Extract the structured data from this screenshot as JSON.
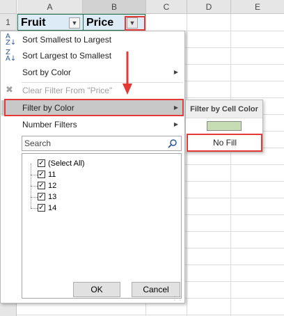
{
  "grid": {
    "columns": [
      "A",
      "B",
      "C",
      "D",
      "E"
    ],
    "rows": [
      "1"
    ],
    "header_fill_color": "#ddebf7",
    "cells": {
      "a1": "Fruit",
      "b1": "Price"
    }
  },
  "filter_menu": {
    "items": [
      {
        "label": "Sort Smallest to Largest",
        "icon": "sort-ascending-icon"
      },
      {
        "label": "Sort Largest to Smallest",
        "icon": "sort-descending-icon"
      },
      {
        "label": "Sort by Color",
        "icon": "",
        "has_submenu": true
      },
      {
        "label": "Clear Filter From \"Price\"",
        "icon": "clear-filter-icon",
        "disabled": true
      },
      {
        "label": "Filter by Color",
        "icon": "",
        "has_submenu": true,
        "highlighted": true
      },
      {
        "label": "Number Filters",
        "icon": "",
        "has_submenu": true
      }
    ],
    "search": {
      "placeholder": "Search",
      "icon": "search-icon"
    },
    "values": [
      {
        "label": "(Select All)",
        "checked": true
      },
      {
        "label": "11",
        "checked": true
      },
      {
        "label": "12",
        "checked": true
      },
      {
        "label": "13",
        "checked": true
      },
      {
        "label": "14",
        "checked": true
      }
    ],
    "ok_label": "OK",
    "cancel_label": "Cancel"
  },
  "color_submenu": {
    "title": "Filter by Cell Color",
    "swatch_color": "#c6dcb3",
    "no_fill_label": "No Fill"
  },
  "accent_color": "#e53935"
}
